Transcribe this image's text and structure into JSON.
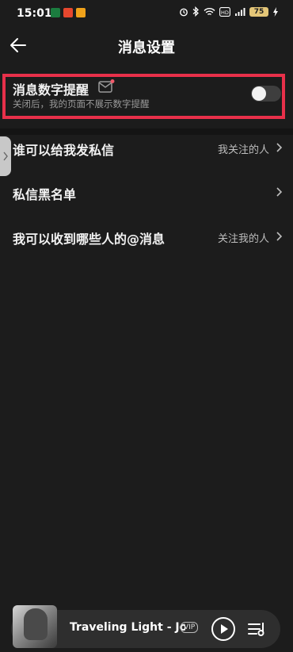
{
  "statusbar": {
    "time": "15:01",
    "battery": "75",
    "app_icon_colors": [
      "#1b7c3f",
      "#e6472e",
      "#f0a21a"
    ],
    "icons": [
      "alarm-icon",
      "bluetooth-icon",
      "wifi-icon",
      "hd-icon",
      "signal-icon",
      "charging-icon"
    ]
  },
  "header": {
    "title": "消息设置",
    "back_icon": "arrow-left-icon"
  },
  "settings": {
    "badge_reminder": {
      "label": "消息数字提醒",
      "description": "关闭后，我的页面不展示数字提醒",
      "icon": "message-badge-icon",
      "enabled": false
    },
    "who_can_message": {
      "label": "谁可以给我发私信",
      "value": "我关注的人"
    },
    "dm_blacklist": {
      "label": "私信黑名单"
    },
    "mention_from": {
      "label": "我可以收到哪些人的@消息",
      "value": "关注我的人"
    }
  },
  "player": {
    "song_title": "Traveling Light - Joel",
    "vip_badge": "VIP",
    "play_icon": "play-icon",
    "playlist_icon": "playlist-icon"
  },
  "colors": {
    "background": "#1c1c1c",
    "highlight_border": "#e8304a",
    "battery": "#e4c678"
  }
}
